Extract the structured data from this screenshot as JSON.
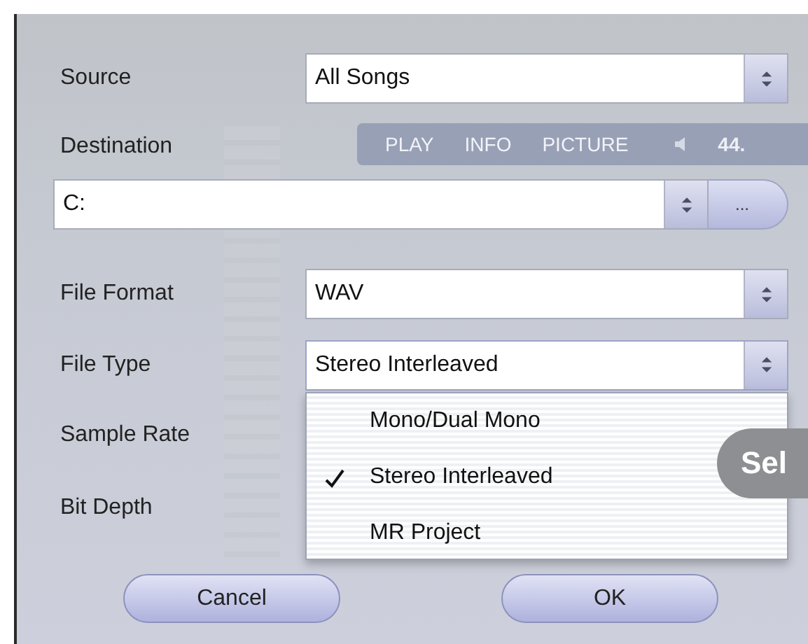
{
  "background_app": {
    "tabs": [
      "PLAY",
      "INFO",
      "PICTURE"
    ],
    "reading": "44."
  },
  "fields": [
    {
      "kind": "select",
      "label": "Source",
      "value": "All Songs"
    },
    {
      "kind": "label",
      "label": "Destination"
    },
    {
      "kind": "path",
      "value": "C:",
      "browse": "..."
    },
    {
      "kind": "select",
      "label": "File Format",
      "value": "WAV"
    },
    {
      "kind": "select",
      "label": "File Type",
      "value": "Stereo Interleaved",
      "expanded": true,
      "options": [
        {
          "label": "Mono/Dual Mono",
          "selected": false
        },
        {
          "label": "Stereo Interleaved",
          "selected": true
        },
        {
          "label": "MR Project",
          "selected": false
        }
      ]
    },
    {
      "kind": "label",
      "label": "Sample Rate"
    },
    {
      "kind": "label",
      "label": "Bit Depth"
    }
  ],
  "badge": "Sel",
  "buttons": [
    "Cancel",
    "OK"
  ]
}
